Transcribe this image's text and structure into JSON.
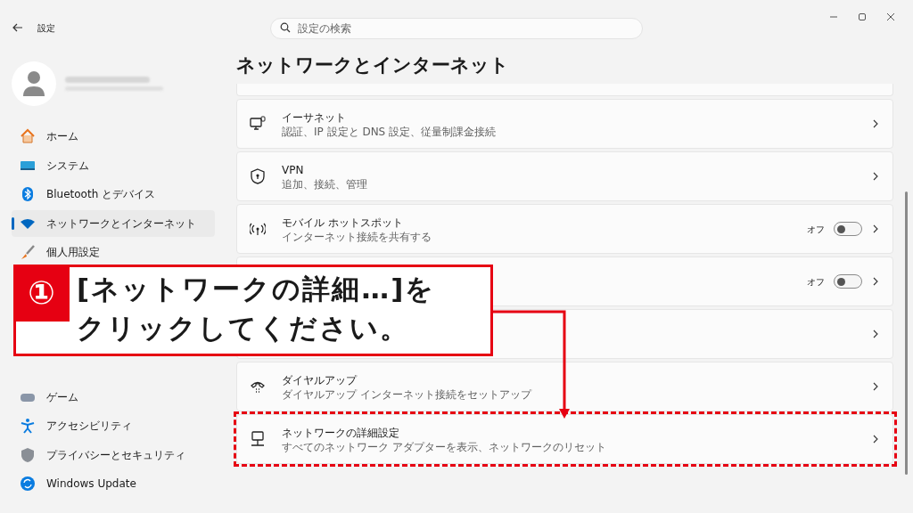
{
  "window": {
    "title": "設定"
  },
  "search": {
    "placeholder": "設定の検索"
  },
  "sidebar": {
    "items": [
      {
        "label": "ホーム",
        "selected": false
      },
      {
        "label": "システム",
        "selected": false
      },
      {
        "label": "Bluetooth とデバイス",
        "selected": false
      },
      {
        "label": "ネットワークとインターネット",
        "selected": true
      },
      {
        "label": "個人用設定",
        "selected": false
      },
      {
        "label": "ゲーム",
        "selected": false
      },
      {
        "label": "アクセシビリティ",
        "selected": false
      },
      {
        "label": "プライバシーとセキュリティ",
        "selected": false
      },
      {
        "label": "Windows Update",
        "selected": false
      }
    ]
  },
  "page_title": "ネットワークとインターネット",
  "rows": [
    {
      "title": "イーサネット",
      "subtitle": "認証、IP 設定と DNS 設定、従量制課金接続",
      "highlighted": false
    },
    {
      "title": "VPN",
      "subtitle": "追加、接続、管理",
      "highlighted": false
    },
    {
      "title": "モバイル ホットスポット",
      "subtitle": "インターネット接続を共有する",
      "toggle": {
        "label": "オフ",
        "on": false
      },
      "highlighted": false
    },
    {
      "toggle": {
        "label": "オフ",
        "on": false
      },
      "highlighted": false
    },
    {
      "highlighted": false
    },
    {
      "title": "ダイヤルアップ",
      "subtitle": "ダイヤルアップ インターネット接続をセットアップ",
      "highlighted": false
    },
    {
      "title": "ネットワークの詳細設定",
      "subtitle": "すべてのネットワーク アダプターを表示、ネットワークのリセット",
      "highlighted": true
    }
  ],
  "callout": {
    "step": "①",
    "lines": [
      "[ネットワークの詳細…]を",
      "クリックしてください。"
    ]
  }
}
